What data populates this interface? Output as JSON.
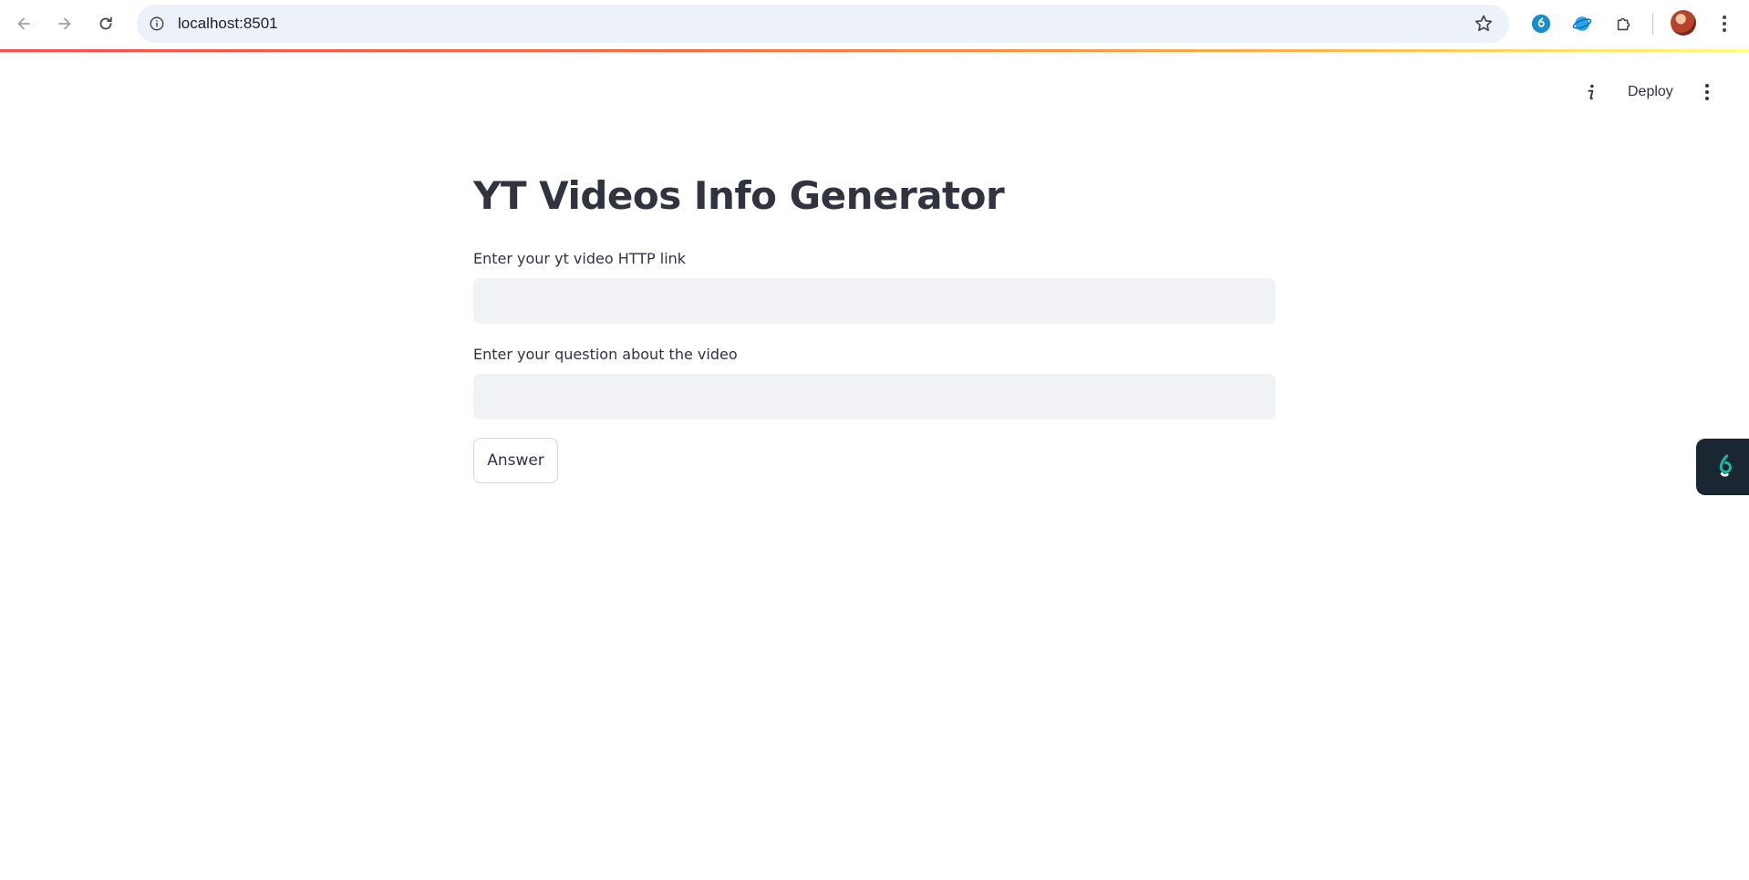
{
  "browser": {
    "url": "localhost:8501",
    "icons": {
      "back": "arrow-left-icon",
      "forward": "arrow-right-icon",
      "reload": "reload-icon",
      "site_info": "info-icon",
      "bookmark": "star-icon",
      "extensions": "puzzle-icon",
      "menu": "kebab-icon"
    }
  },
  "header": {
    "deploy_label": "Deploy",
    "accent_gradient": [
      "#ff4b4b",
      "#ffb347",
      "#fffd80"
    ]
  },
  "main": {
    "title": "YT Videos Info Generator",
    "link_field": {
      "label": "Enter your yt video HTTP link",
      "value": ""
    },
    "question_field": {
      "label": "Enter your question about the video",
      "value": ""
    },
    "answer_button": "Answer"
  },
  "colors": {
    "text": "#31333f",
    "input_bg": "#f0f2f6",
    "widget_bg": "#1a2733",
    "widget_accent": "#1bb5a4"
  }
}
